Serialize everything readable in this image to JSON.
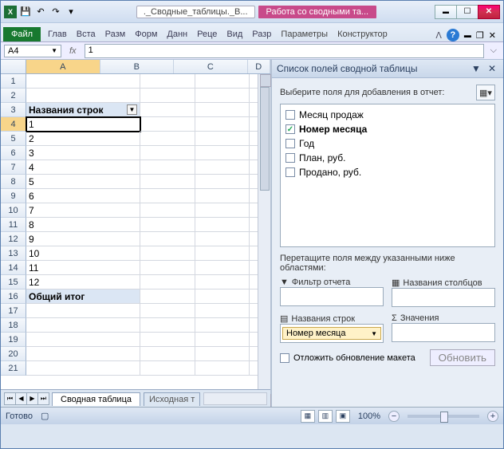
{
  "title": {
    "doc": "._Сводные_таблицы._В...",
    "context": "Работа со сводными та..."
  },
  "ribbon": {
    "file": "Файл",
    "tabs": [
      "Глав",
      "Вста",
      "Разм",
      "Форм",
      "Данн",
      "Реце",
      "Вид",
      "Разр"
    ],
    "ctx": [
      "Параметры",
      "Конструктор"
    ]
  },
  "namebox": "A4",
  "formula": "1",
  "columns": [
    "A",
    "B",
    "C",
    "D"
  ],
  "rows": [
    {
      "n": "1",
      "a": ""
    },
    {
      "n": "2",
      "a": ""
    },
    {
      "n": "3",
      "a": "Названия строк",
      "hdr": true
    },
    {
      "n": "4",
      "a": "1",
      "sel": true
    },
    {
      "n": "5",
      "a": "2"
    },
    {
      "n": "6",
      "a": "3"
    },
    {
      "n": "7",
      "a": "4"
    },
    {
      "n": "8",
      "a": "5"
    },
    {
      "n": "9",
      "a": "6"
    },
    {
      "n": "10",
      "a": "7"
    },
    {
      "n": "11",
      "a": "8"
    },
    {
      "n": "12",
      "a": "9"
    },
    {
      "n": "13",
      "a": "10"
    },
    {
      "n": "14",
      "a": "11"
    },
    {
      "n": "15",
      "a": "12"
    },
    {
      "n": "16",
      "a": "Общий итог",
      "total": true
    },
    {
      "n": "17",
      "a": ""
    },
    {
      "n": "18",
      "a": ""
    },
    {
      "n": "19",
      "a": ""
    },
    {
      "n": "20",
      "a": ""
    },
    {
      "n": "21",
      "a": ""
    }
  ],
  "sheets": {
    "nav": [
      "⏮",
      "◀",
      "▶",
      "⏭"
    ],
    "active": "Сводная таблица",
    "other": "Исходная т"
  },
  "pane": {
    "title": "Список полей сводной таблицы",
    "sub": "Выберите поля для добавления в отчет:",
    "fields": [
      {
        "name": "Месяц продаж",
        "checked": false
      },
      {
        "name": "Номер месяца",
        "checked": true
      },
      {
        "name": "Год",
        "checked": false
      },
      {
        "name": "План, руб.",
        "checked": false
      },
      {
        "name": "Продано, руб.",
        "checked": false
      }
    ],
    "draghelp": "Перетащите поля между указанными ниже областями:",
    "zone_filter": "Фильтр отчета",
    "zone_cols": "Названия столбцов",
    "zone_rows": "Названия строк",
    "zone_vals": "Значения",
    "row_field": "Номер месяца",
    "defer": "Отложить обновление макета",
    "update": "Обновить"
  },
  "status": {
    "ready": "Готово",
    "zoom": "100%"
  }
}
